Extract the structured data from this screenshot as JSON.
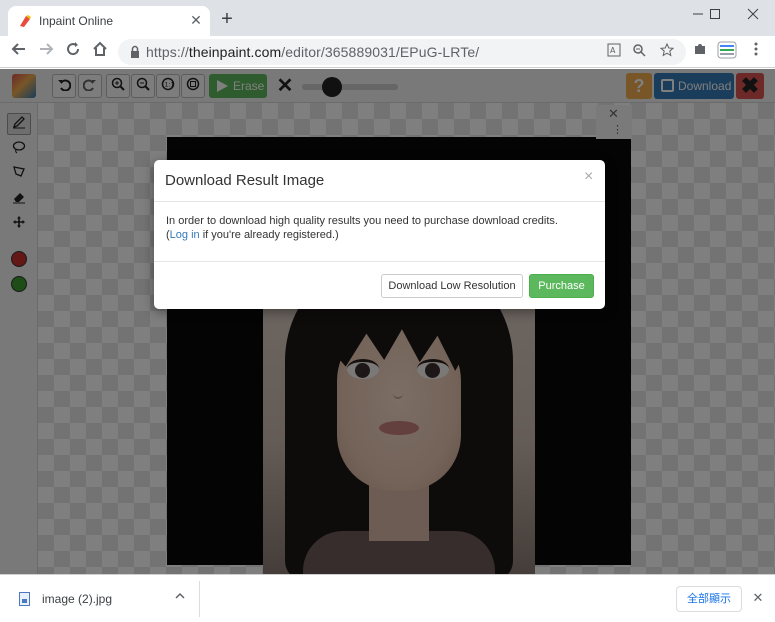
{
  "browser": {
    "tab_title": "Inpaint Online",
    "tab_close": "✕",
    "new_tab": "+",
    "url_prefix": "https://",
    "url_host": "theinpaint.com",
    "url_path": "/editor/365889031/EPuG-LRTe/"
  },
  "app": {
    "erase_label": "Erase",
    "help_label": "?",
    "download_label": "Download",
    "close_label": "✖"
  },
  "modal": {
    "title": "Download Result Image",
    "close": "×",
    "body_line1": "In order to download high quality results you need to purchase download credits.",
    "body_open_paren": "(",
    "login_link": "Log in",
    "body_line2_rest": " if you're already registered.)",
    "low_res_button": "Download Low Resolution",
    "purchase_button": "Purchase"
  },
  "shelf": {
    "file_name": "image (2).jpg",
    "show_all": "全部顯示"
  },
  "colors": {
    "red_marker": "#c9302c",
    "green_marker": "#3c9a2e",
    "accent_blue": "#337ab7",
    "accent_green": "#5cb85c"
  }
}
